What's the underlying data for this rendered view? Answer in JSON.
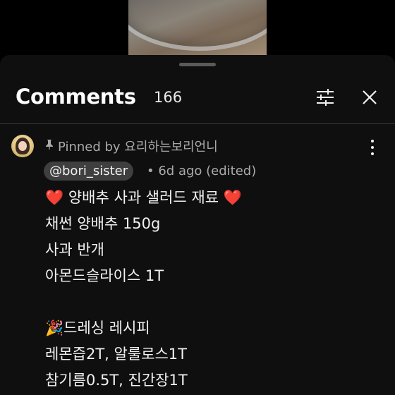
{
  "header": {
    "title": "Comments",
    "count": "166"
  },
  "comment": {
    "pinned_text": "Pinned by 요리하는보리언니",
    "author": "@bori_sister",
    "meta": "• 6d ago (edited)",
    "lines": [
      "❤️ 양배추 사과 샐러드 재료 ❤️",
      "채썬 양배추 150g",
      "사과 반개",
      "아몬드슬라이스 1T",
      "",
      "🎉드레싱 레시피",
      "레몬즙2T, 알룰로스1T",
      "참기름0.5T, 진간장1T"
    ]
  },
  "icons": {
    "filter": "sliders-icon",
    "close": "close-icon",
    "pin": "pin-icon",
    "more": "more-vertical-icon"
  }
}
